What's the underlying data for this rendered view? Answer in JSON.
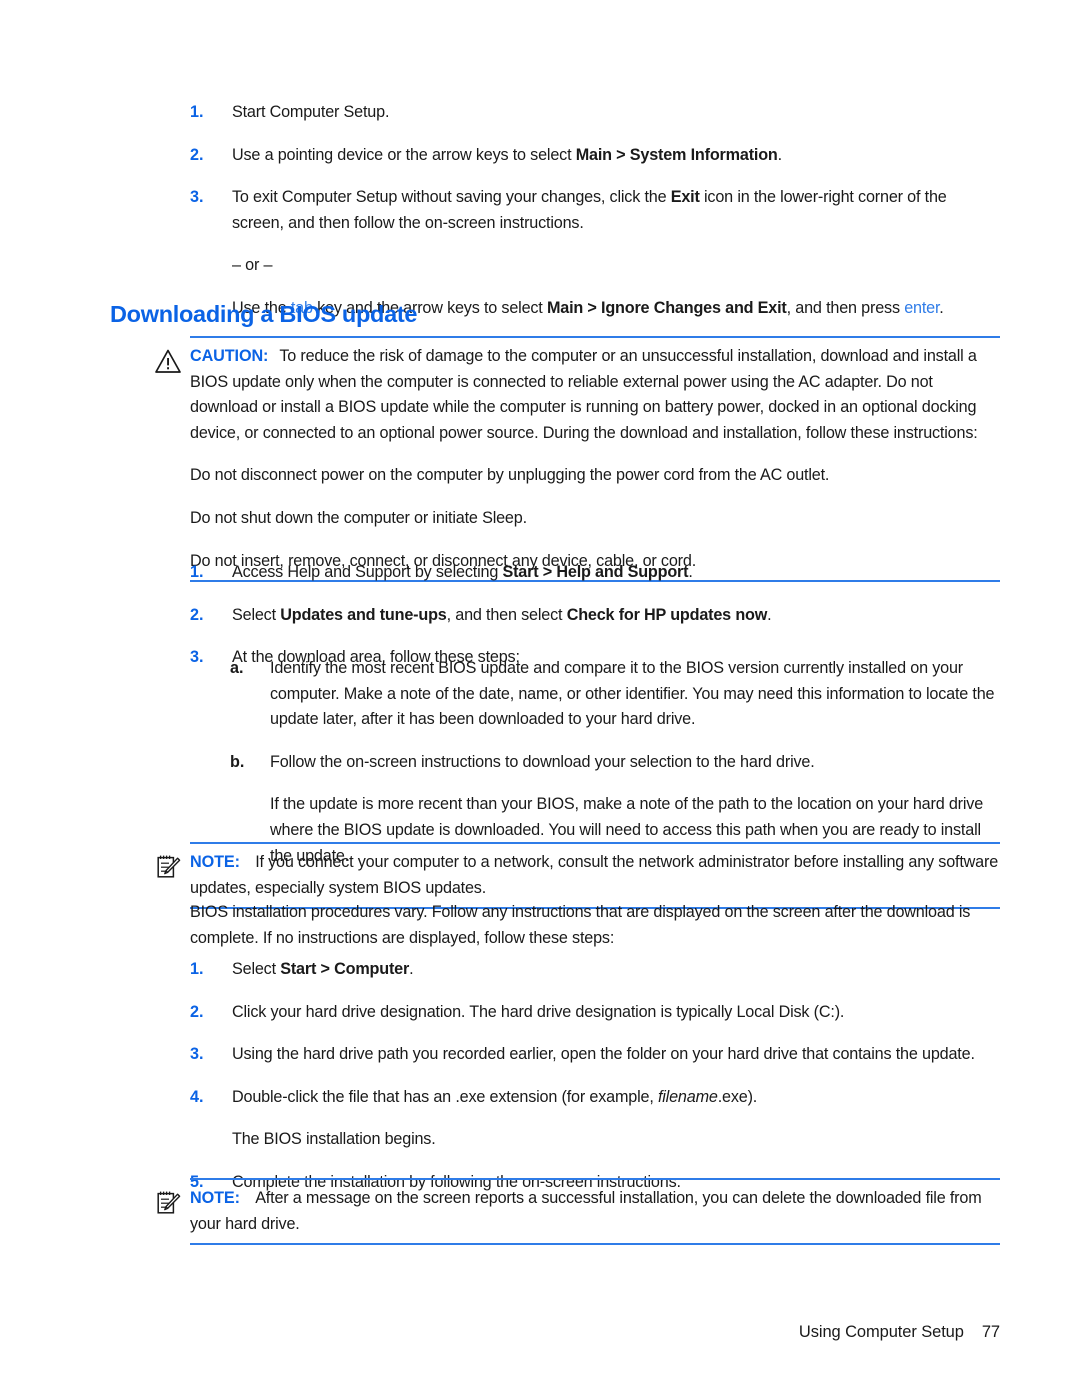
{
  "document": {
    "heading": "Downloading a BIOS update",
    "footer": {
      "chapter_title": "Using Computer Setup",
      "page_number": "77"
    }
  },
  "top_list": {
    "items": [
      {
        "marker": "1.",
        "segments": [
          {
            "text": "Start Computer Setup.",
            "style": "normal"
          }
        ]
      },
      {
        "marker": "2.",
        "segments": [
          {
            "text": "Use a pointing device or the arrow keys to select ",
            "style": "normal"
          },
          {
            "text": "Main > System Information",
            "style": "bold"
          },
          {
            "text": ".",
            "style": "normal"
          }
        ]
      },
      {
        "marker": "3.",
        "segments": [
          {
            "text": "To exit Computer Setup without saving your changes, click the ",
            "style": "normal"
          },
          {
            "text": "Exit",
            "style": "bold"
          },
          {
            "text": " icon in the lower-right corner of the screen, and then follow the on-screen instructions.",
            "style": "normal"
          }
        ],
        "extra_paragraphs": [
          {
            "segments": [
              {
                "text": "– or –",
                "style": "normal"
              }
            ]
          },
          {
            "segments": [
              {
                "text": "Use the ",
                "style": "normal"
              },
              {
                "text": "tab",
                "style": "link"
              },
              {
                "text": " key and the arrow keys to select ",
                "style": "normal"
              },
              {
                "text": "Main > Ignore Changes and Exit",
                "style": "bold"
              },
              {
                "text": ", and then press ",
                "style": "normal"
              },
              {
                "text": "enter",
                "style": "link"
              },
              {
                "text": ".",
                "style": "normal"
              }
            ]
          }
        ]
      }
    ]
  },
  "caution": {
    "icon": "warning-triangle-icon",
    "label": "CAUTION:",
    "paragraphs": [
      {
        "segments": [
          {
            "text": "To reduce the risk of damage to the computer or an unsuccessful installation, download and install a BIOS update only when the computer is connected to reliable external power using the AC adapter. Do not download or install a BIOS update while the computer is running on battery power, docked in an optional docking device, or connected to an optional power source. During the download and installation, follow these instructions:",
            "style": "normal"
          }
        ]
      },
      {
        "segments": [
          {
            "text": "Do not disconnect power on the computer by unplugging the power cord from the AC outlet.",
            "style": "normal"
          }
        ]
      },
      {
        "segments": [
          {
            "text": "Do not shut down the computer or initiate Sleep.",
            "style": "normal"
          }
        ]
      },
      {
        "segments": [
          {
            "text": "Do not insert, remove, connect, or disconnect any device, cable, or cord.",
            "style": "normal"
          }
        ]
      }
    ]
  },
  "download_list": {
    "items": [
      {
        "marker": "1.",
        "segments": [
          {
            "text": "Access Help and Support by selecting ",
            "style": "normal"
          },
          {
            "text": "Start > Help and Support",
            "style": "bold"
          },
          {
            "text": ".",
            "style": "normal"
          }
        ]
      },
      {
        "marker": "2.",
        "segments": [
          {
            "text": "Select ",
            "style": "normal"
          },
          {
            "text": "Updates and tune-ups",
            "style": "bold"
          },
          {
            "text": ", and then select ",
            "style": "normal"
          },
          {
            "text": "Check for HP updates now",
            "style": "bold"
          },
          {
            "text": ".",
            "style": "normal"
          }
        ]
      },
      {
        "marker": "3.",
        "segments": [
          {
            "text": "At the download area, follow these steps:",
            "style": "normal"
          }
        ]
      }
    ]
  },
  "sub_list": {
    "items": [
      {
        "marker": "a.",
        "segments": [
          {
            "text": "Identify the most recent BIOS update and compare it to the BIOS version currently installed on your computer. Make a note of the date, name, or other identifier. You may need this information to locate the update later, after it has been downloaded to your hard drive.",
            "style": "normal"
          }
        ]
      },
      {
        "marker": "b.",
        "segments": [
          {
            "text": "Follow the on-screen instructions to download your selection to the hard drive.",
            "style": "normal"
          }
        ],
        "extra_paragraphs": [
          {
            "segments": [
              {
                "text": "If the update is more recent than your BIOS, make a note of the path to the location on your hard drive where the BIOS update is downloaded. You will need to access this path when you are ready to install the update.",
                "style": "normal"
              }
            ]
          }
        ]
      }
    ]
  },
  "note_network": {
    "icon": "notepad-pencil-icon",
    "label": "NOTE:",
    "text": "If you connect your computer to a network, consult the network administrator before installing any software updates, especially system BIOS updates."
  },
  "intro_paragraph": {
    "text": "BIOS installation procedures vary. Follow any instructions that are displayed on the screen after the download is complete. If no instructions are displayed, follow these steps:"
  },
  "install_list": {
    "items": [
      {
        "marker": "1.",
        "segments": [
          {
            "text": "Select ",
            "style": "normal"
          },
          {
            "text": "Start > Computer",
            "style": "bold"
          },
          {
            "text": ".",
            "style": "normal"
          }
        ]
      },
      {
        "marker": "2.",
        "segments": [
          {
            "text": "Click your hard drive designation. The hard drive designation is typically Local Disk (C:).",
            "style": "normal"
          }
        ]
      },
      {
        "marker": "3.",
        "segments": [
          {
            "text": "Using the hard drive path you recorded earlier, open the folder on your hard drive that contains the update.",
            "style": "normal"
          }
        ]
      },
      {
        "marker": "4.",
        "segments": [
          {
            "text": "Double-click the file that has an .exe extension (for example, ",
            "style": "normal"
          },
          {
            "text": "filename",
            "style": "italic"
          },
          {
            "text": ".exe).",
            "style": "normal"
          }
        ],
        "extra_paragraphs": [
          {
            "segments": [
              {
                "text": "The BIOS installation begins.",
                "style": "normal"
              }
            ]
          }
        ]
      },
      {
        "marker": "5.",
        "segments": [
          {
            "text": "Complete the installation by following the on-screen instructions.",
            "style": "normal"
          }
        ]
      }
    ]
  },
  "note_delete": {
    "icon": "notepad-pencil-icon",
    "label": "NOTE:",
    "text": "After a message on the screen reports a successful installation, you can delete the downloaded file from your hard drive."
  },
  "colors": {
    "accent_blue": "#0b63e5",
    "rule_blue": "#2f7ce8",
    "body_text": "#1a1a1a"
  }
}
